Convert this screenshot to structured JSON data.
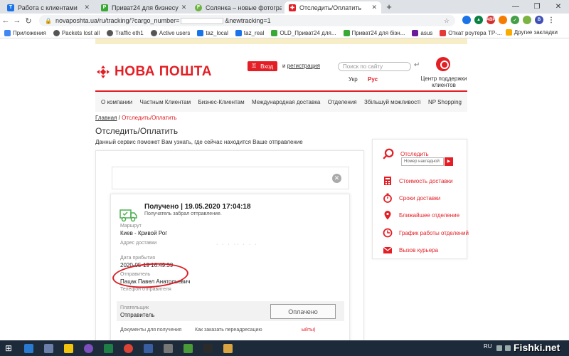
{
  "browser": {
    "tabs": [
      {
        "title": "Работа с клиентами",
        "color": "#1a73e8"
      },
      {
        "title": "Приват24 для бизнесу",
        "color": "#39a935"
      },
      {
        "title": "Солянка – новые фотографии, ",
        "color": "#6cb33e"
      },
      {
        "title": "Отследить/Оплатить",
        "color": "#e31e24"
      }
    ],
    "new_tab": "+",
    "url_prefix": "novaposhta.ua/ru/tracking/?cargo_number=",
    "url_suffix": "&newtracking=1",
    "bookmarks": [
      {
        "label": "Приложения",
        "color": "#4285f4"
      },
      {
        "label": "Packets lost all",
        "color": "#555555"
      },
      {
        "label": "Traffic eth1",
        "color": "#555555"
      },
      {
        "label": "Active users",
        "color": "#555555"
      },
      {
        "label": "taz_local",
        "color": "#1a73e8"
      },
      {
        "label": "taz_real",
        "color": "#1a73e8"
      },
      {
        "label": "OLD_Приват24 для...",
        "color": "#39a935"
      },
      {
        "label": "Приват24 для бізн...",
        "color": "#39a935"
      },
      {
        "label": "asus",
        "color": "#6a1b9a"
      },
      {
        "label": "Откат роутера TP-...",
        "color": "#e53935"
      }
    ],
    "other_bookmarks": "Другие закладки"
  },
  "header": {
    "logo_text": "НОВА ПОШТА",
    "login": "Вход",
    "register_prefix": "и",
    "register": "регистрация",
    "search_placeholder": "Поиск по сайту",
    "lang_ua": "Укр",
    "lang_ru": "Рус",
    "support": "Центр поддержки клиентов"
  },
  "menu": [
    "О компании",
    "Частным Клиентам",
    "Бизнес-Клиентам",
    "Международная доставка",
    "Отделения",
    "Збільшуй можливості",
    "NP Shopping"
  ],
  "breadcrumb": {
    "home": "Главная",
    "sep": "/",
    "current": "Отследить/Оплатить"
  },
  "page_title": "Отследить/Оплатить",
  "subtitle": "Данный сервис поможет Вам узнать, где сейчас находится Ваше отправление",
  "tracking": {
    "status": "Получено | 19.05.2020 17:04:18",
    "status_sub": "Получатель забрал отправление.",
    "route_label": "Маршрут",
    "route": "Киев - Кривой Рог",
    "address_label": "Адрес доставки",
    "arrival_label": "Дата прибытия",
    "arrival": "2020-05-19 16:49:39",
    "sender_label": "Отправитель",
    "sender": "Пацак Павел Анатольевич",
    "sender_phone_label": "Телефон отправителя",
    "payer_label": "Плательщик",
    "payer": "Отправитель",
    "paid_button": "Оплачено",
    "docs_label": "Документы для получения",
    "redirect_label": "Как заказать переадресацию",
    "redirect_tail": "ыйты)"
  },
  "sidebar": {
    "track": "Отследить",
    "track_placeholder": "Номер накладной",
    "cost": "Стоимость доставки",
    "terms": "Сроки доставки",
    "nearest": "Ближайшее отделение",
    "schedule": "График работы отделений",
    "courier": "Вызов курьера"
  },
  "taskbar": {
    "lang": "RU",
    "watermark": "Fishki.net"
  },
  "colors": {
    "brand": "#e31e24",
    "menu_bg": "#f6f6f6"
  }
}
